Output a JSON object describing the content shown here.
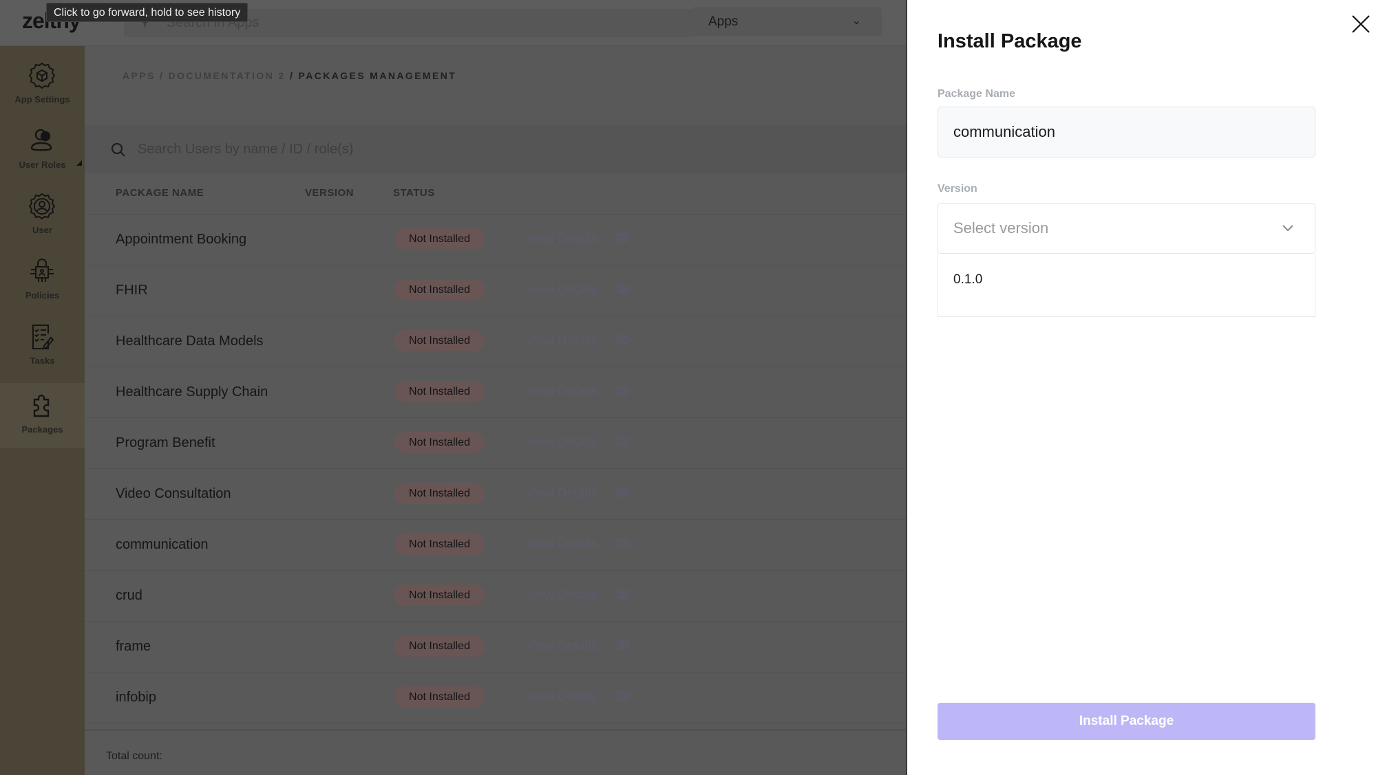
{
  "tooltip": "Click to go forward, hold to see history",
  "header": {
    "logo": "zelthy",
    "search_placeholder": "Search in Apps",
    "app_select": "Apps"
  },
  "sidebar": {
    "items": [
      {
        "label": "App Settings",
        "icon": "gear-box-icon"
      },
      {
        "label": "User Roles",
        "icon": "users-icon"
      },
      {
        "label": "User",
        "icon": "user-gear-icon"
      },
      {
        "label": "Policies",
        "icon": "lock-circuit-icon"
      },
      {
        "label": "Tasks",
        "icon": "task-list-icon"
      },
      {
        "label": "Packages",
        "icon": "puzzle-icon",
        "active": true
      }
    ]
  },
  "breadcrumb": {
    "path": "APPS / DOCUMENTATION 2",
    "current": "/ PACKAGES MANAGEMENT"
  },
  "table": {
    "search_placeholder": "Search Users by name / ID / role(s)",
    "columns": [
      "PACKAGE NAME",
      "VERSION",
      "STATUS"
    ],
    "rows": [
      {
        "name": "Appointment Booking",
        "status": "Not Installed",
        "action": "View Details"
      },
      {
        "name": "FHIR",
        "status": "Not Installed",
        "action": "View Details"
      },
      {
        "name": "Healthcare Data Models",
        "status": "Not Installed",
        "action": "View Details"
      },
      {
        "name": "Healthcare Supply Chain",
        "status": "Not Installed",
        "action": "View Details"
      },
      {
        "name": "Program Benefit",
        "status": "Not Installed",
        "action": "View Details"
      },
      {
        "name": "Video Consultation",
        "status": "Not Installed",
        "action": "View Details"
      },
      {
        "name": "communication",
        "status": "Not Installed",
        "action": "View Details"
      },
      {
        "name": "crud",
        "status": "Not Installed",
        "action": "View Details"
      },
      {
        "name": "frame",
        "status": "Not Installed",
        "action": "View Details"
      },
      {
        "name": "infobip",
        "status": "Not Installed",
        "action": "View Details"
      }
    ],
    "total_label": "Total count:"
  },
  "panel": {
    "title": "Install Package",
    "package_name_label": "Package Name",
    "package_name_value": "communication",
    "version_label": "Version",
    "version_placeholder": "Select version",
    "version_options": [
      "0.1.0"
    ],
    "install_button": "Install Package",
    "button_color": "#beb7f7"
  }
}
